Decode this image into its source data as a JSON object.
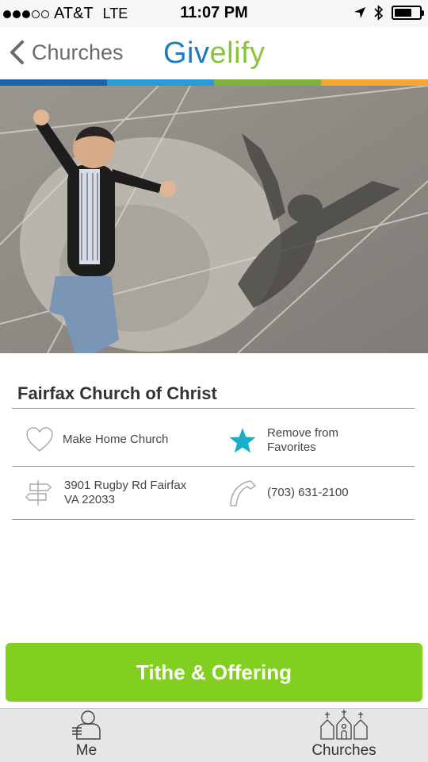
{
  "status_bar": {
    "carrier": "AT&T",
    "network": "LTE",
    "time": "11:07 PM",
    "signal_bars_filled": 3,
    "signal_bars_total": 5,
    "battery_level": 0.7
  },
  "nav": {
    "back_label": "Churches",
    "logo": {
      "part1": "Giv",
      "part2": "elify",
      "brand_blue": "#1e7cc0",
      "brand_green": "#8bc53f"
    }
  },
  "stripe_colors": [
    "#1e62a8",
    "#2a9bd6",
    "#82b040",
    "#f4a534"
  ],
  "church": {
    "name": "Fairfax Church of Christ",
    "home_label": "Make Home Church",
    "favorite_label": "Remove from Favorites",
    "address": "3901 Rugby Rd Fairfax VA 22033",
    "phone": "(703) 631-2100",
    "accent": "#1aaec8"
  },
  "cta": {
    "label": "Tithe & Offering",
    "color": "#82cf21"
  },
  "tabs": [
    {
      "label": "Me",
      "icon": "person-icon"
    },
    {
      "label": "Churches",
      "icon": "churches-icon"
    }
  ]
}
